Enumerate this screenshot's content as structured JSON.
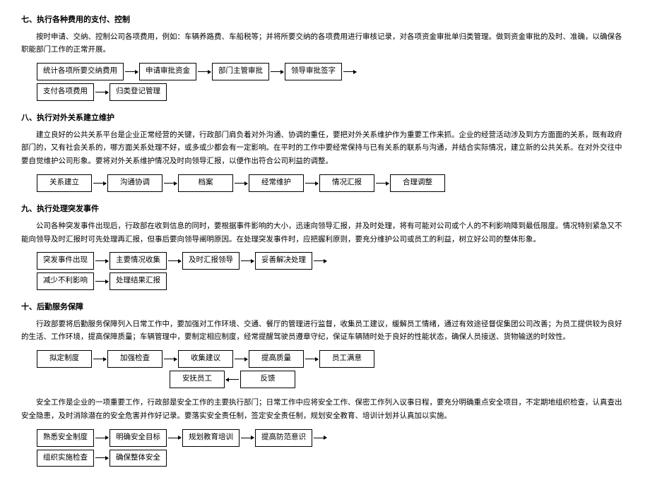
{
  "sections": {
    "seven": {
      "heading": "七、执行各种费用的支付、控制",
      "para": "按时申请、交纳、控制公司各项费用，例如：车辆养路费、车船税等；并将所要交纳的各项费用进行审核记录，对各项资金审批单归类管理。做到资金审批的及时、准确，以确保各职能部门工作的正常开展。",
      "row1": [
        "统计各项所要交纳费用",
        "申请审批资金",
        "部门主管审批",
        "领导审批签字"
      ],
      "row2": [
        "支付各项费用",
        "归类登记管理"
      ]
    },
    "eight": {
      "heading": "八、执行对外关系建立维护",
      "para": "建立良好的公共关系平台是企业正常经营的关键，行政部门肩负着对外沟通、协调的重任，要把对外关系维护作为重要工作来抓。企业的经营活动涉及到方方面面的关系，既有政府部门的，又有社会关系的，哪方面关系处理不好，或多或少都会有一定影响。在平时的工作中要经常保持与已有关系的联系与沟通，并结合实际情况，建立新的公共关系。在对外交往中要自觉维护公司形象。要将对外关系维护情况及时向领导汇报，以便作出符合公司利益的调整。",
      "row1": [
        "关系建立",
        "沟通协调",
        "档案",
        "经常维护",
        "情况汇报",
        "合理调整"
      ]
    },
    "nine": {
      "heading": "九、执行处理突发事件",
      "para": "公司各种突发事件出现后，行政部在收到信息的同时，要根据事件影响的大小，迅速向领导汇报，并及时处理，将有可能对公司或个人的不利影响降到最低限度。情况特别紧急又不能向领导及时汇报时可先处理再汇报，但事后要向领导阐明原因。在处理突发事件时，应把握利原则，要充分维护公司或员工的利益，树立好公司的整体形象。",
      "row1": [
        "突发事件出现",
        "主要情况收集",
        "及时汇报领导",
        "妥善解决处理"
      ],
      "row2": [
        "减少不利影响",
        "处理结果汇报"
      ]
    },
    "ten": {
      "heading": "十、后勤服务保障",
      "para1": "行政部要将后勤服务保障列入日常工作中，要加强对工作环境、交通、餐厅的管理进行监督，收集员工建议，缓解员工情绪，通过有效途径督促集团公司改善；为员工提供较为良好的生活、工作环境，提高保障质量；车辆管理中，要制定相应制度，经常提醒驾驶员遵章守纪，保证车辆随时处于良好的性能状态，确保人员接送、货物输送的时效性。",
      "row1": [
        "拟定制度",
        "加强检查",
        "收集建议",
        "提高质量",
        "员工满意"
      ],
      "row2": [
        "安抚员工",
        "反馈"
      ],
      "para2": "安全工作是企业的一项重要工作，行政部是安全工作的主要执行部门；日常工作中应将安全工作、保密工作列入议事日程，要充分明确重点安全项目，不定期地组织检查，认真查出安全隐患，及时消除潜在的安全危害并作好记录。要落实安全责任制，签定安全责任制，规划安全教育、培训计划并认真加以实施。",
      "row3": [
        "熟悉安全制度",
        "明确安全目标",
        "规划教育培训",
        "提高防范意识"
      ],
      "row4": [
        "组织实施检查",
        "确保整体安全"
      ]
    }
  }
}
